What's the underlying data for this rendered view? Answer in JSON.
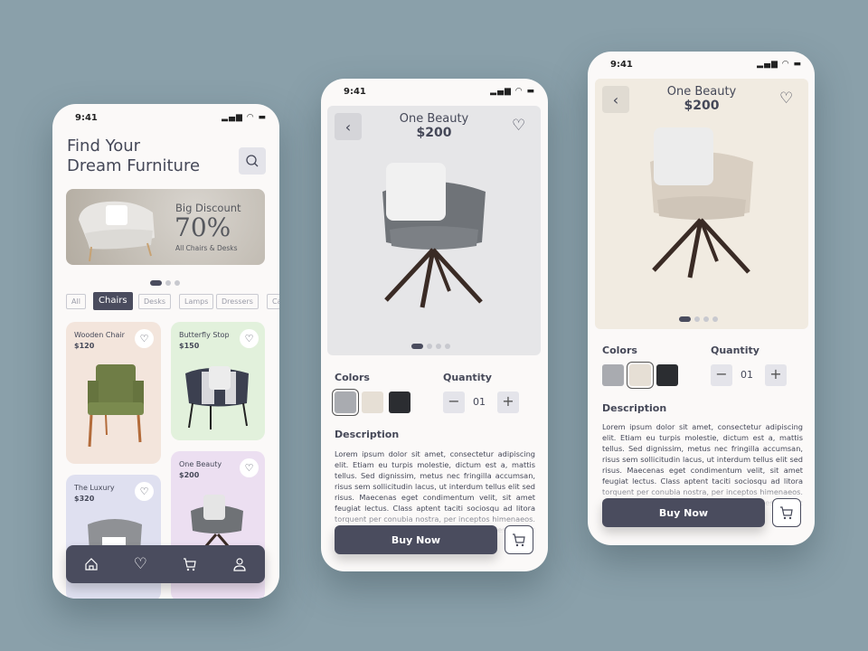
{
  "status": {
    "time": "9:41"
  },
  "home": {
    "title_line1": "Find Your",
    "title_line2": "Dream Furniture",
    "banner": {
      "heading": "Big Discount",
      "percent": "70%",
      "sub": "All Chairs & Desks"
    },
    "categories": [
      "All",
      "Chairs",
      "Desks",
      "Lamps",
      "Dressers",
      "Ca"
    ],
    "selected_category": "Chairs",
    "products": [
      {
        "name": "Wooden Chair",
        "price": "$120",
        "bg": "#f3e5dc"
      },
      {
        "name": "Butterfly Stop",
        "price": "$150",
        "bg": "#e2f1dc"
      },
      {
        "name": "The Luxury",
        "price": "$320",
        "bg": "#dfe0f0"
      },
      {
        "name": "One Beauty",
        "price": "$200",
        "bg": "#ecdff1"
      }
    ],
    "nav": [
      "home-icon",
      "heart-icon",
      "cart-icon",
      "user-icon"
    ]
  },
  "detail": {
    "name": "One Beauty",
    "price": "$200",
    "colors_label": "Colors",
    "quantity_label": "Quantity",
    "quantity": "01",
    "description_label": "Description",
    "description": "Lorem ipsum dolor sit amet, consectetur adipiscing elit. Etiam eu turpis molestie, dictum est a, mattis tellus. Sed dignissim, metus nec fringilla accumsan, risus sem sollicitudin lacus, ut interdum tellus elit sed risus. Maecenas eget condimentum velit, sit amet feugiat lectus. Class aptent taciti sociosqu ad litora torquent per conubia nostra, per inceptos himenaeos. Praesent auctor purus luctus enim egestas, ac scelerisque ante pulvinar.",
    "buy_label": "Buy Now",
    "colors": [
      "#a9abb0",
      "#e6dfd5",
      "#2b2d31"
    ],
    "gray_variant_selected": "#a9abb0",
    "beige_variant_selected": "#e6dfd5"
  }
}
